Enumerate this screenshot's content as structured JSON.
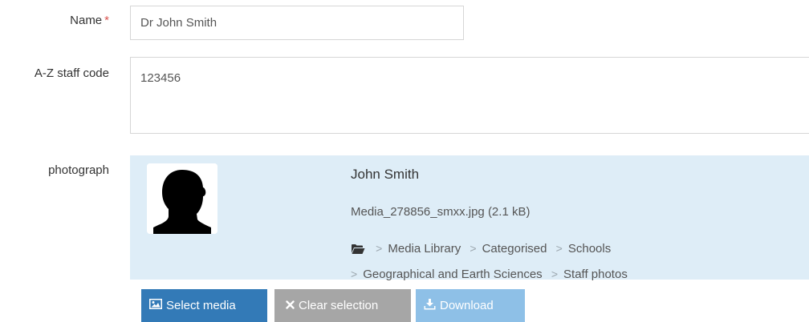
{
  "form": {
    "name": {
      "label": "Name",
      "required_marker": "*",
      "value": "Dr John Smith"
    },
    "staff_code": {
      "label": "A-Z staff code",
      "value": "123456"
    },
    "photograph": {
      "label": "photograph",
      "media": {
        "title": "John Smith",
        "file": "Media_278856_smxx.jpg (2.1 kB)",
        "folder_icon": "folder-open-icon",
        "path": [
          "Media Library",
          "Categorised",
          "Schools",
          "Geographical and Earth Sciences",
          "Staff photos"
        ]
      },
      "buttons": {
        "select": {
          "label": "Select media",
          "icon": "image-icon"
        },
        "clear": {
          "label": "Clear selection",
          "icon": "times-icon"
        },
        "download": {
          "label": "Download",
          "icon": "download-icon"
        }
      }
    }
  },
  "colors": {
    "required": "#d9534f",
    "panel_bg": "#deedf7",
    "primary": "#337ab7",
    "secondary": "#a6a6a6",
    "info_light": "#8ec0e7"
  }
}
